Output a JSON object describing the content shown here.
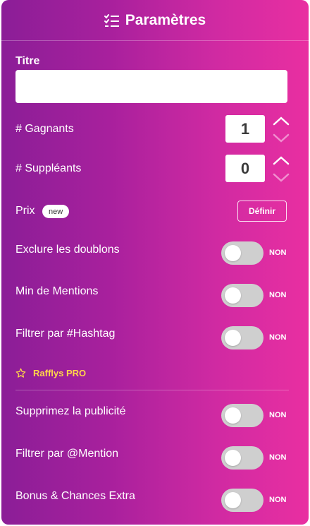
{
  "header": {
    "title": "Paramètres",
    "icon": "checklist-icon"
  },
  "title_field": {
    "label": "Titre",
    "value": ""
  },
  "winners": {
    "label": "# Gagnants",
    "value": "1"
  },
  "substitutes": {
    "label": "# Suppléants",
    "value": "0"
  },
  "prize": {
    "label": "Prix",
    "badge": "new",
    "button": "Définir"
  },
  "toggles": [
    {
      "label": "Exclure les doublons",
      "state": "NON",
      "on": false
    },
    {
      "label": "Min de Mentions",
      "state": "NON",
      "on": false
    },
    {
      "label": "Filtrer par #Hashtag",
      "state": "NON",
      "on": false
    }
  ],
  "pro": {
    "label": "Rafflys PRO",
    "icon": "star-icon",
    "color": "#ffd54a"
  },
  "pro_toggles": [
    {
      "label": "Supprimez la publicité",
      "state": "NON",
      "on": false
    },
    {
      "label": "Filtrer par @Mention",
      "state": "NON",
      "on": false
    },
    {
      "label": "Bonus & Chances Extra",
      "state": "NON",
      "on": false
    }
  ],
  "colors": {
    "gradient_start": "#8b1e97",
    "gradient_end": "#e92fa1",
    "toggle_off": "#cfcfcf"
  }
}
